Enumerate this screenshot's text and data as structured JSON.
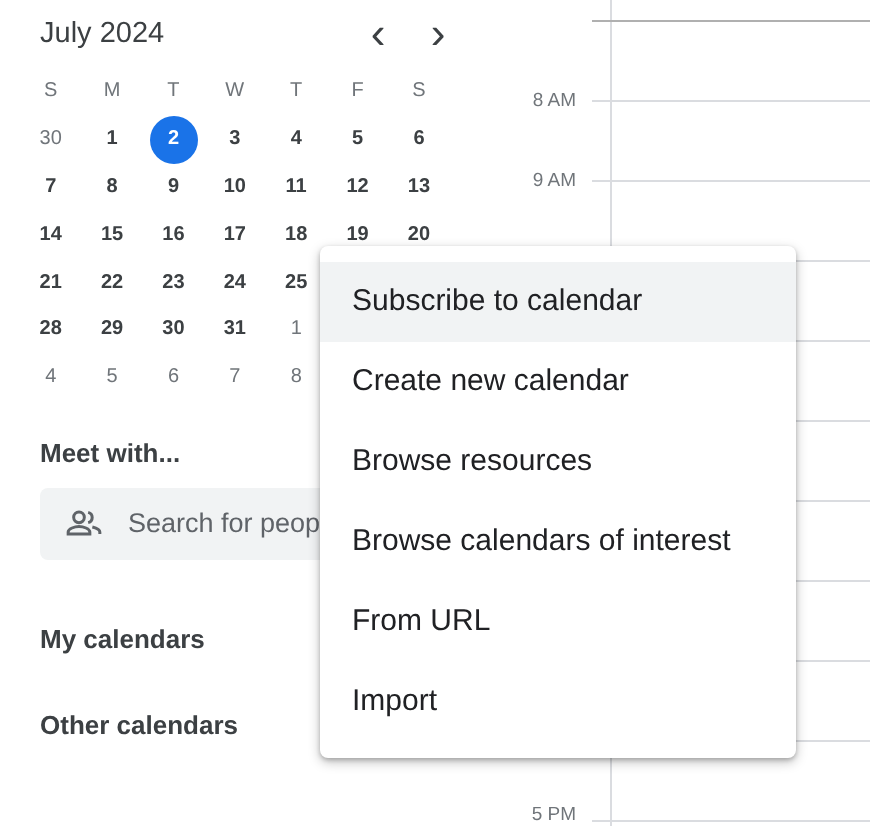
{
  "mini_calendar": {
    "title": "July 2024",
    "prev": "‹",
    "next": "›",
    "weekdays": [
      "S",
      "M",
      "T",
      "W",
      "T",
      "F",
      "S"
    ],
    "weeks": [
      [
        {
          "day": "30",
          "other_month": true,
          "selected": false
        },
        {
          "day": "1",
          "other_month": false,
          "selected": false
        },
        {
          "day": "2",
          "other_month": false,
          "selected": true
        },
        {
          "day": "3",
          "other_month": false,
          "selected": false
        },
        {
          "day": "4",
          "other_month": false,
          "selected": false
        },
        {
          "day": "5",
          "other_month": false,
          "selected": false
        },
        {
          "day": "6",
          "other_month": false,
          "selected": false
        }
      ],
      [
        {
          "day": "7",
          "other_month": false,
          "selected": false
        },
        {
          "day": "8",
          "other_month": false,
          "selected": false
        },
        {
          "day": "9",
          "other_month": false,
          "selected": false
        },
        {
          "day": "10",
          "other_month": false,
          "selected": false
        },
        {
          "day": "11",
          "other_month": false,
          "selected": false
        },
        {
          "day": "12",
          "other_month": false,
          "selected": false
        },
        {
          "day": "13",
          "other_month": false,
          "selected": false
        }
      ],
      [
        {
          "day": "14",
          "other_month": false,
          "selected": false
        },
        {
          "day": "15",
          "other_month": false,
          "selected": false
        },
        {
          "day": "16",
          "other_month": false,
          "selected": false
        },
        {
          "day": "17",
          "other_month": false,
          "selected": false
        },
        {
          "day": "18",
          "other_month": false,
          "selected": false
        },
        {
          "day": "19",
          "other_month": false,
          "selected": false
        },
        {
          "day": "20",
          "other_month": false,
          "selected": false
        }
      ],
      [
        {
          "day": "21",
          "other_month": false,
          "selected": false
        },
        {
          "day": "22",
          "other_month": false,
          "selected": false
        },
        {
          "day": "23",
          "other_month": false,
          "selected": false
        },
        {
          "day": "24",
          "other_month": false,
          "selected": false
        },
        {
          "day": "25",
          "other_month": false,
          "selected": false
        }
      ],
      [
        {
          "day": "28",
          "other_month": false,
          "selected": false
        },
        {
          "day": "29",
          "other_month": false,
          "selected": false
        },
        {
          "day": "30",
          "other_month": false,
          "selected": false
        },
        {
          "day": "31",
          "other_month": false,
          "selected": false
        },
        {
          "day": "1",
          "other_month": true,
          "selected": false
        }
      ],
      [
        {
          "day": "4",
          "other_month": true,
          "selected": false
        },
        {
          "day": "5",
          "other_month": true,
          "selected": false
        },
        {
          "day": "6",
          "other_month": true,
          "selected": false
        },
        {
          "day": "7",
          "other_month": true,
          "selected": false
        },
        {
          "day": "8",
          "other_month": true,
          "selected": false
        }
      ]
    ]
  },
  "meet_with": {
    "heading": "Meet with...",
    "search": {
      "placeholder": "Search for peop"
    }
  },
  "sections": [
    "My calendars",
    "Other calendars"
  ],
  "time_grid": {
    "rows": [
      {},
      {
        "label": "8 AM"
      },
      {
        "label": "9 AM"
      },
      {},
      {},
      {},
      {},
      {},
      {},
      {},
      {
        "label": "5 PM"
      }
    ]
  },
  "menu": {
    "items": [
      {
        "label": "Subscribe to calendar",
        "selected": true
      },
      {
        "label": "Create new calendar",
        "selected": false
      },
      {
        "label": "Browse resources",
        "selected": false
      },
      {
        "label": "Browse calendars of interest",
        "selected": false
      },
      {
        "label": "From URL",
        "selected": false
      },
      {
        "label": "Import",
        "selected": false
      }
    ]
  }
}
